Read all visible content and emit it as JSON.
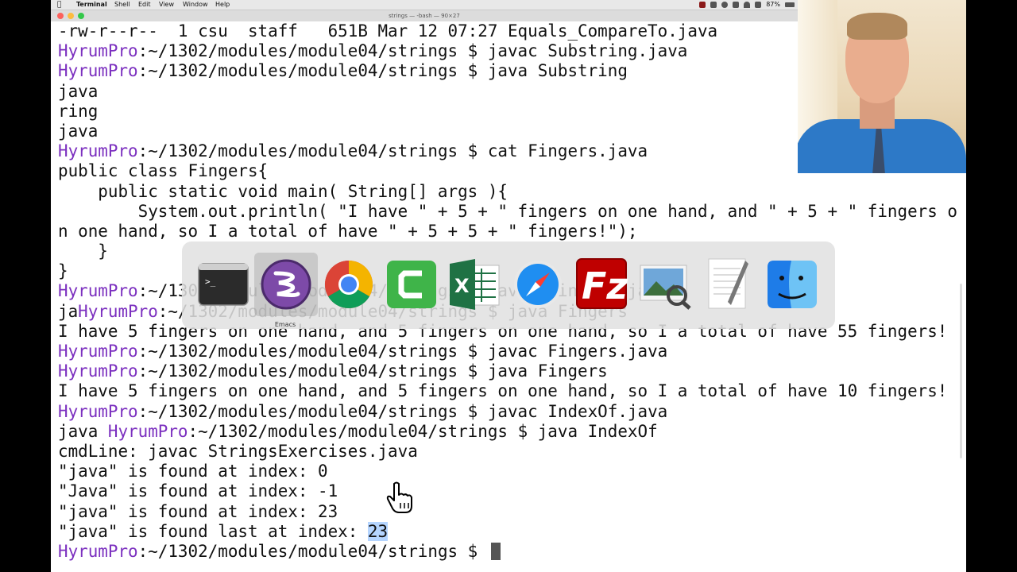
{
  "menubar": {
    "app": "Terminal",
    "items": [
      "Shell",
      "Edit",
      "View",
      "Window",
      "Help"
    ],
    "battery": "87%"
  },
  "window": {
    "title": "strings — -bash — 90×27"
  },
  "terminal": {
    "lines": [
      [
        {
          "t": "-rw-r--r--  1 csu  staff   651B Mar 12 07:27 Equals_CompareTo.java"
        }
      ],
      [
        {
          "t": "HyrumPro",
          "p": 1
        },
        {
          "t": ":~/1302/modules/module04/strings $ javac Substring.java"
        }
      ],
      [
        {
          "t": "HyrumPro",
          "p": 1
        },
        {
          "t": ":~/1302/modules/module04/strings $ java Substring"
        }
      ],
      [
        {
          "t": "java"
        }
      ],
      [
        {
          "t": "ring"
        }
      ],
      [
        {
          "t": "java"
        }
      ],
      [
        {
          "t": "HyrumPro",
          "p": 1
        },
        {
          "t": ":~/1302/modules/module04/strings $ cat Fingers.java"
        }
      ],
      [
        {
          "t": "public class Fingers{"
        }
      ],
      [
        {
          "t": "    public static void main( String[] args ){"
        }
      ],
      [
        {
          "t": "        System.out.println( \"I have \" + 5 + \" fingers on one hand, and \" + 5 + \" fingers o"
        }
      ],
      [
        {
          "t": "n one hand, so I a total of have \" + 5 + 5 + \" fingers!\");"
        }
      ],
      [
        {
          "t": "    }"
        }
      ],
      [
        {
          "t": "}"
        }
      ],
      [
        {
          "t": "HyrumPro",
          "p": 1
        },
        {
          "t": ":~/1302/modules/module04/strings $ javac Fingers.java"
        }
      ],
      [
        {
          "t": "ja"
        },
        {
          "t": "HyrumPro",
          "p": 1
        },
        {
          "t": ":~/1302/modules/module04/strings $ java Fingers"
        }
      ],
      [
        {
          "t": "I have 5 fingers on one hand, and 5 fingers on one hand, so I a total of have 55 fingers!"
        }
      ],
      [
        {
          "t": "HyrumPro",
          "p": 1
        },
        {
          "t": ":~/1302/modules/module04/strings $ javac Fingers.java"
        }
      ],
      [
        {
          "t": "HyrumPro",
          "p": 1
        },
        {
          "t": ":~/1302/modules/module04/strings $ java Fingers"
        }
      ],
      [
        {
          "t": "I have 5 fingers on one hand, and 5 fingers on one hand, so I a total of have 10 fingers!"
        }
      ],
      [
        {
          "t": "HyrumPro",
          "p": 1
        },
        {
          "t": ":~/1302/modules/module04/strings $ javac IndexOf.java"
        }
      ],
      [
        {
          "t": "java "
        },
        {
          "t": "HyrumPro",
          "p": 1
        },
        {
          "t": ":~/1302/modules/module04/strings $ java IndexOf"
        }
      ],
      [
        {
          "t": "cmdLine: javac StringsExercises.java"
        }
      ],
      [
        {
          "t": "\"java\" is found at index: 0"
        }
      ],
      [
        {
          "t": "\"Java\" is found at index: -1"
        }
      ],
      [
        {
          "t": "\"java\" is found at index: 23"
        }
      ],
      [
        {
          "t": "\"java\" is found last at index: "
        },
        {
          "t": "23",
          "h": 1
        }
      ],
      [
        {
          "t": "HyrumPro",
          "p": 1
        },
        {
          "t": ":~/1302/modules/module04/strings $ "
        },
        {
          "c": 1
        }
      ]
    ]
  },
  "dock": {
    "items": [
      {
        "name": "terminal",
        "icon": "terminal-icon"
      },
      {
        "name": "emacs",
        "icon": "emacs-icon",
        "label": "Emacs"
      },
      {
        "name": "chrome",
        "icon": "chrome-icon"
      },
      {
        "name": "camtasia",
        "icon": "camtasia-icon"
      },
      {
        "name": "excel",
        "icon": "excel-icon"
      },
      {
        "name": "safari",
        "icon": "safari-icon"
      },
      {
        "name": "filezilla",
        "icon": "filezilla-icon"
      },
      {
        "name": "preview",
        "icon": "preview-icon"
      },
      {
        "name": "textedit",
        "icon": "textedit-icon"
      },
      {
        "name": "finder",
        "icon": "finder-icon"
      }
    ]
  },
  "colors": {
    "prompt": "#7b2fbf",
    "selection": "#b5d5ff",
    "dock_bg": "#e1e1e1"
  }
}
